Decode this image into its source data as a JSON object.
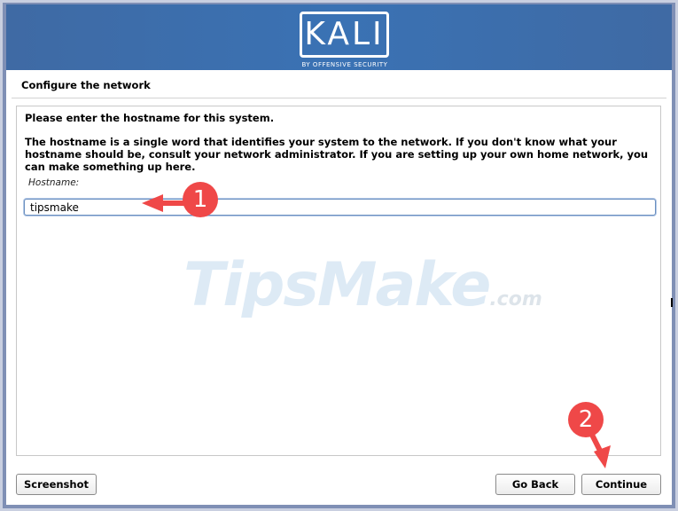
{
  "header": {
    "logo_text": "KALI",
    "logo_subtitle": "BY OFFENSIVE SECURITY"
  },
  "page": {
    "section_title": "Configure the network",
    "prompt": "Please enter the hostname for this system.",
    "description": "The hostname is a single word that identifies your system to the network. If you don't know what your hostname should be, consult your network administrator. If you are setting up your own home network, you can make something up here.",
    "field_label": "Hostname:",
    "hostname_value": "tipsmake"
  },
  "watermark": {
    "main": "TipsMake",
    "suffix": ".com"
  },
  "annotations": {
    "step1": "1",
    "step2": "2",
    "accent_color": "#ef4848"
  },
  "buttons": {
    "screenshot": "Screenshot",
    "go_back": "Go Back",
    "continue": "Continue"
  },
  "colors": {
    "banner": "#3a72b4",
    "frame": "#7f8fb5",
    "input_border": "#6a8fc0"
  }
}
